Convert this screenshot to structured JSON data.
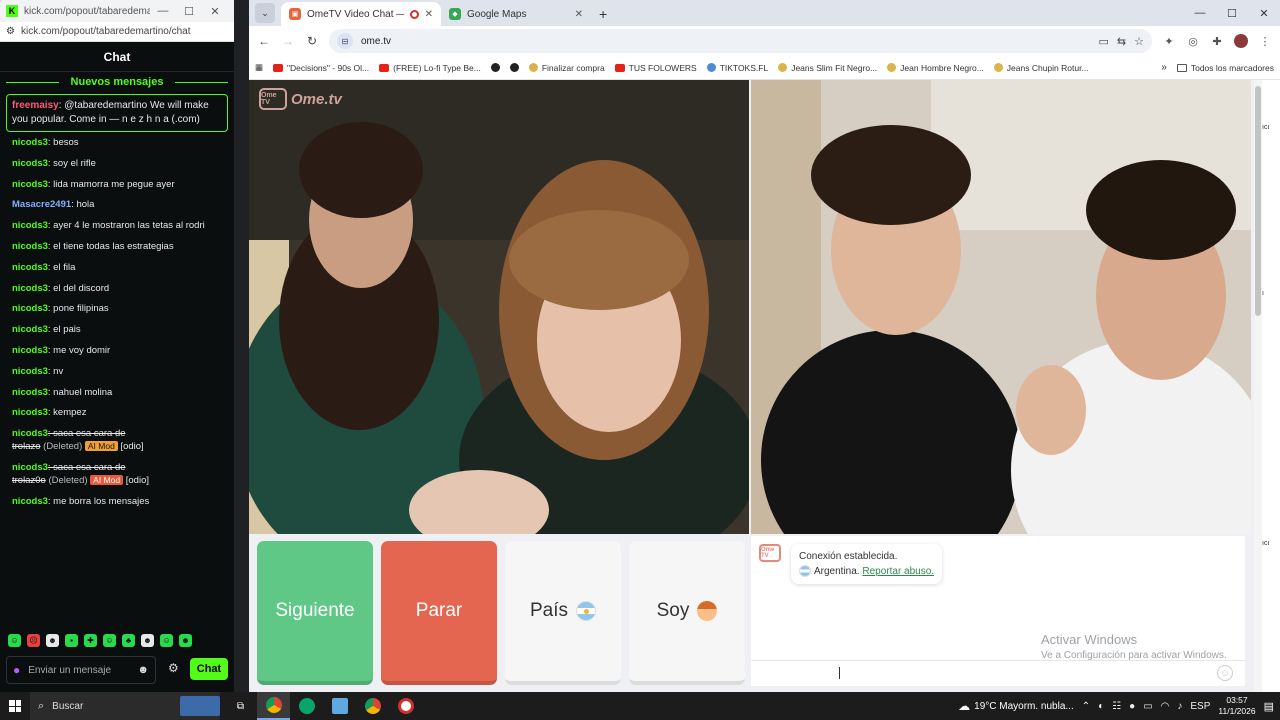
{
  "kick": {
    "window_title": "kick.com/popout/tabaredemartino/chat",
    "url": "kick.com/popout/tabaredemartino/chat",
    "chat_title": "Chat",
    "new_messages": "Nuevos mensajes",
    "pinned": {
      "user": "freemaisy",
      "text": ": @tabaredemartino We will make you popular. Come in — n e z h n a (.com)"
    },
    "messages": [
      {
        "user": "nicods3",
        "text": ": besos"
      },
      {
        "user": "nicods3",
        "text": ": soy el rifle"
      },
      {
        "user": "nicods3",
        "text": ": lida mamorra me pegue ayer"
      },
      {
        "user": "Masacre2491",
        "text": ": hola"
      },
      {
        "user": "nicods3",
        "text": ": ayer 4 le mostraron las tetas al rodri"
      },
      {
        "user": "nicods3",
        "text": ": el tiene todas las estrategias"
      },
      {
        "user": "nicods3",
        "text": ": el fila"
      },
      {
        "user": "nicods3",
        "text": ": el del discord"
      },
      {
        "user": "nicods3",
        "text": ": pone filipinas"
      },
      {
        "user": "nicods3",
        "text": ": el pais"
      },
      {
        "user": "nicods3",
        "text": ": me voy domir"
      },
      {
        "user": "nicods3",
        "text": ": nv"
      },
      {
        "user": "nicods3",
        "text": ": nahuel molina"
      },
      {
        "user": "nicods3",
        "text": ": kempez"
      }
    ],
    "deleted_1": {
      "user": "nicods3",
      "text": ": saca esa cara de",
      "line2": "trolazo",
      "deleted": "(Deleted)",
      "tag": "AI Mod",
      "reason": "[odio]"
    },
    "deleted_2": {
      "user": "nicods3",
      "text": ": saca esa cara de",
      "line2": "trolaz0o",
      "deleted": "(Deleted)",
      "tag": "AI Mod",
      "reason": "[odio]"
    },
    "last_message": {
      "user": "nicods3",
      "text": ": me borra los mensajes"
    },
    "composer_placeholder": "Enviar un mensaje",
    "chat_button": "Chat"
  },
  "chrome": {
    "tabs": [
      {
        "title": "OmeTV Video Chat — Ome",
        "active": true
      },
      {
        "title": "Google Maps",
        "active": false
      }
    ],
    "url": "ome.tv",
    "bookmarks": [
      "\"Decisions\" - 90s Ol...",
      "(FREE) Lo-fi Type Be...",
      "",
      "",
      "Finalizar compra",
      "TUS FOLOWERS",
      "TIKTOKS.FL",
      "Jeans Slim Fit Negro...",
      "Jean Hombre Negro...",
      "Jeans Chupin Rotur..."
    ],
    "all_bookmarks": "Todos los marcadores"
  },
  "ometv": {
    "logo_small": "Ome TV",
    "logo_text": "Ome.tv",
    "buttons": {
      "next": "Siguiente",
      "stop": "Parar",
      "country": "País",
      "me": "Soy"
    },
    "chat": {
      "avatar": "Ome TV",
      "status": "Conexión establecida.",
      "country": "Argentina.",
      "report": "Reportar abuso."
    },
    "watermark": {
      "line1": "Activar Windows",
      "line2": "Ve a Configuración para activar Windows."
    }
  },
  "taskbar": {
    "search": "Buscar",
    "weather": "19°C  Mayorm. nubla...",
    "lang": "ESP",
    "time": "03:57",
    "date": "11/1/2026"
  },
  "colors": {
    "kick_green": "#53fc18",
    "next_green": "#5fc886",
    "stop_red": "#e56650"
  }
}
